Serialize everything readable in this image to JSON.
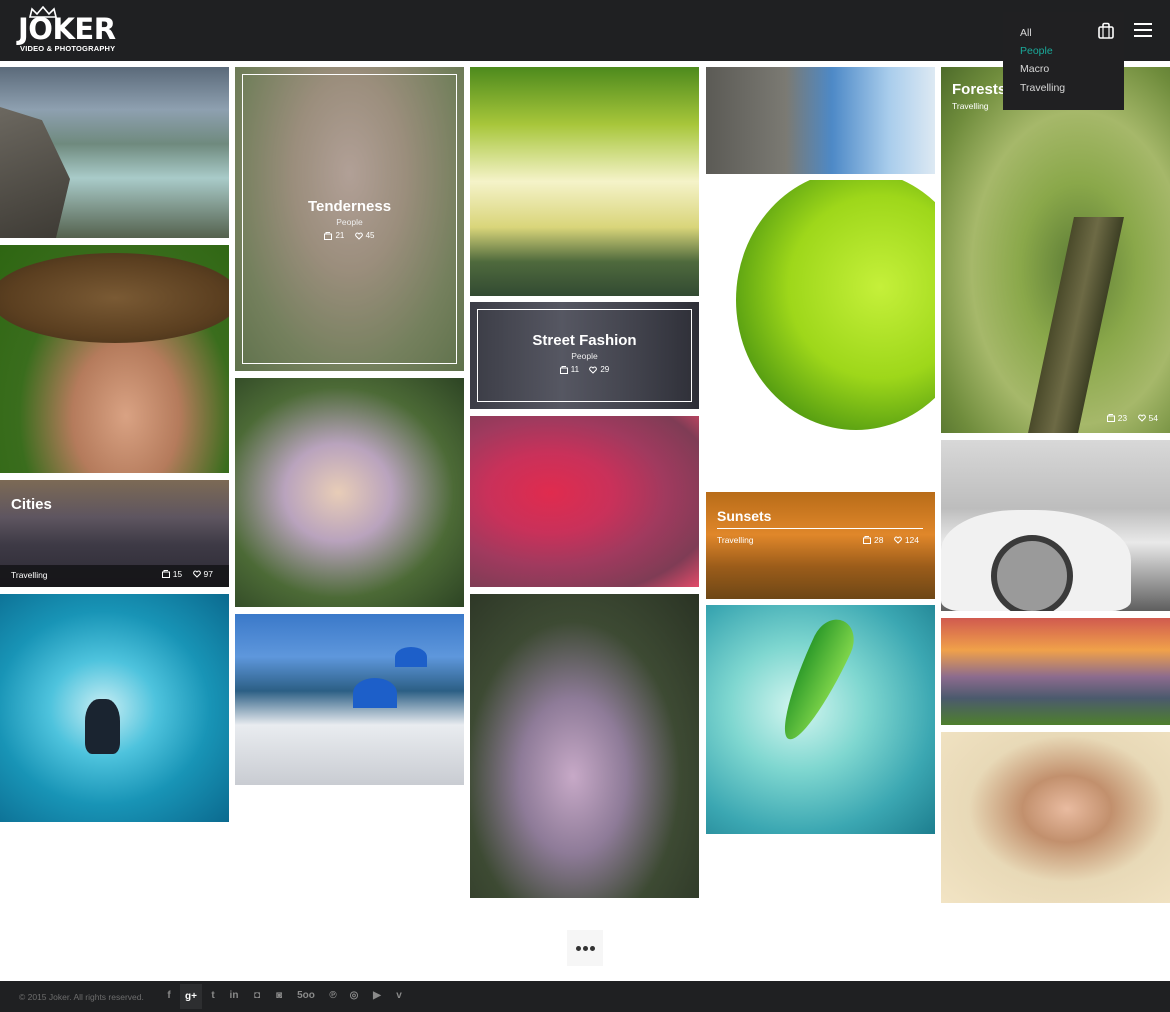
{
  "brand": {
    "name": "JOKER",
    "tagline": "VIDEO & PHOTOGRAPHY"
  },
  "filter_menu": {
    "items": [
      {
        "label": "All",
        "active": false
      },
      {
        "label": "People",
        "active": true
      },
      {
        "label": "Macro",
        "active": false
      },
      {
        "label": "Travelling",
        "active": false
      }
    ],
    "active_color": "#1aa99a"
  },
  "header_icons": {
    "cart": "shopping-bag-icon",
    "menu": "hamburger-menu-icon"
  },
  "gallery": {
    "tenderness": {
      "title": "Tenderness",
      "category": "People",
      "views": "21",
      "likes": "45"
    },
    "street_fashion": {
      "title": "Street Fashion",
      "category": "People",
      "views": "11",
      "likes": "29"
    },
    "cities": {
      "title": "Cities",
      "category": "Travelling",
      "views": "15",
      "likes": "97"
    },
    "sunsets": {
      "title": "Sunsets",
      "category": "Travelling",
      "views": "28",
      "likes": "124"
    },
    "forests": {
      "title": "Forests",
      "category": "Travelling",
      "views": "23",
      "likes": "54"
    }
  },
  "load_more": {
    "icon": "more-dots-icon"
  },
  "footer": {
    "copyright": "© 2015 Joker. All rights reserved.",
    "social": [
      {
        "name": "facebook-icon",
        "glyph": "f"
      },
      {
        "name": "google-plus-icon",
        "glyph": "g+"
      },
      {
        "name": "twitter-icon",
        "glyph": "t"
      },
      {
        "name": "linkedin-icon",
        "glyph": "in"
      },
      {
        "name": "instagram-icon",
        "glyph": "◘"
      },
      {
        "name": "flickr-icon",
        "glyph": "◙"
      },
      {
        "name": "500px-icon",
        "glyph": "5oo"
      },
      {
        "name": "pinterest-icon",
        "glyph": "℗"
      },
      {
        "name": "dribbble-icon",
        "glyph": "◎"
      },
      {
        "name": "youtube-icon",
        "glyph": "▶"
      },
      {
        "name": "vimeo-icon",
        "glyph": "v"
      }
    ]
  }
}
